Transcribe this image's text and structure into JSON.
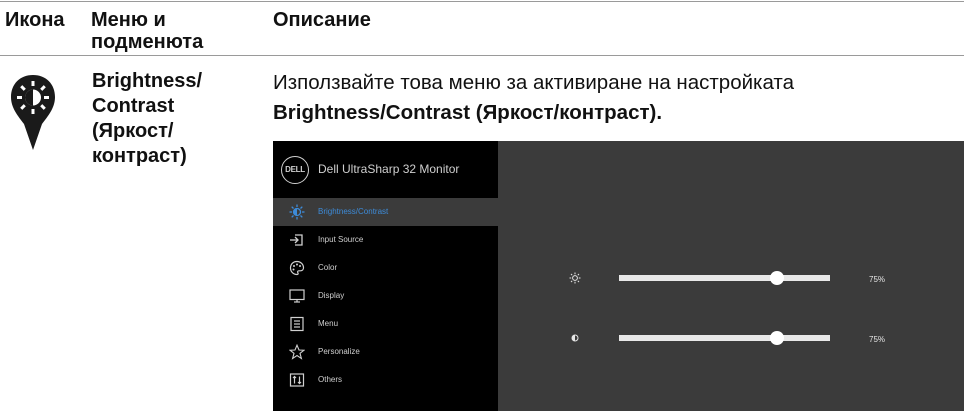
{
  "header": {
    "icon_col": "Икона",
    "menu_col_line1": "Меню и",
    "menu_col_line2": "подменюта",
    "desc_col": "Описание"
  },
  "row": {
    "icon": "brightness-pin-icon",
    "menu_name_lines": [
      "Brightness/",
      "Contrast",
      "(Яркост/",
      "контраст)"
    ],
    "description_line1": "Използвайте това меню за активиране на настройката",
    "description_bold": "Brightness/Contrast (Яркост/контраст)",
    "description_end": "."
  },
  "osd": {
    "logo": "DELL",
    "title": "Dell UltraSharp 32 Monitor",
    "menu_items": [
      {
        "label": "Brightness/Contrast",
        "icon": "brightness-icon",
        "active": true
      },
      {
        "label": "Input Source",
        "icon": "input-source-icon",
        "active": false
      },
      {
        "label": "Color",
        "icon": "color-palette-icon",
        "active": false
      },
      {
        "label": "Display",
        "icon": "display-icon",
        "active": false
      },
      {
        "label": "Menu",
        "icon": "menu-icon",
        "active": false
      },
      {
        "label": "Personalize",
        "icon": "star-icon",
        "active": false
      },
      {
        "label": "Others",
        "icon": "others-icon",
        "active": false
      }
    ],
    "sliders": [
      {
        "name": "Brightness",
        "icon": "sun-icon",
        "value": 75,
        "value_text": "75%"
      },
      {
        "name": "Contrast",
        "icon": "contrast-icon",
        "value": 75,
        "value_text": "75%"
      }
    ],
    "colors": {
      "sidebar": "#000000",
      "panel": "#3b3b3b",
      "active_label": "#3d8bd8"
    }
  }
}
